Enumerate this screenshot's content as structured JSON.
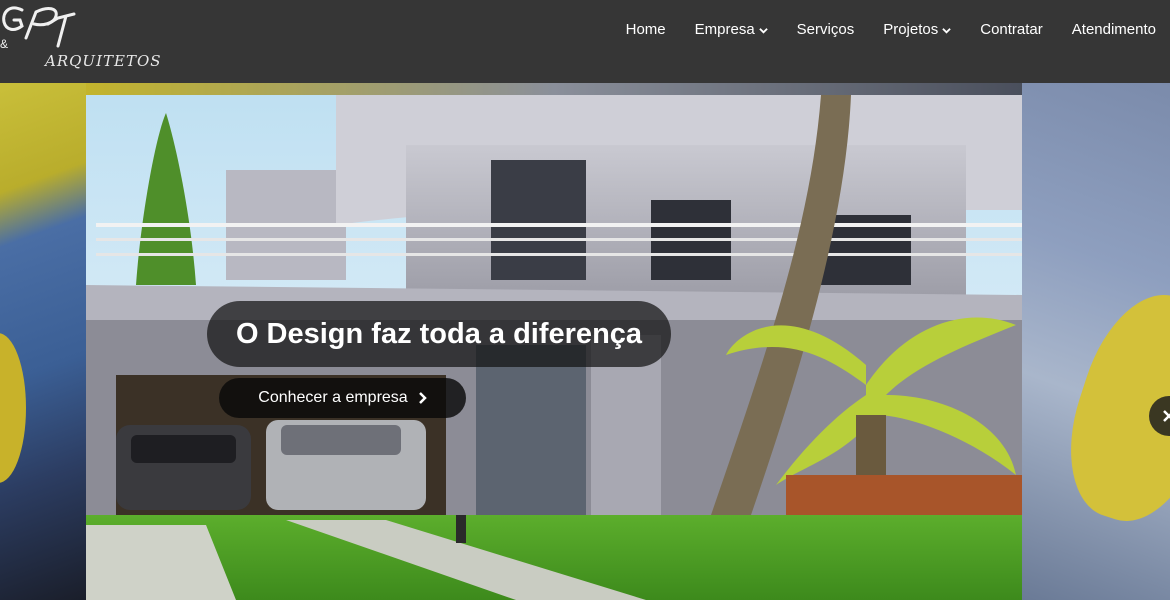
{
  "header": {
    "logo_ampersand": "&",
    "logo_sub": "ARQUITETOS"
  },
  "nav": {
    "items": [
      {
        "label": "Home",
        "dropdown": false
      },
      {
        "label": "Empresa",
        "dropdown": true
      },
      {
        "label": "Serviços",
        "dropdown": false
      },
      {
        "label": "Projetos",
        "dropdown": true
      },
      {
        "label": "Contratar",
        "dropdown": false
      },
      {
        "label": "Atendimento",
        "dropdown": false
      }
    ]
  },
  "slider": {
    "title": "O Design faz toda a diferença",
    "button_label": "Conhecer a empresa"
  },
  "colors": {
    "topbar": "#363636",
    "caption_bg": "#141414"
  }
}
